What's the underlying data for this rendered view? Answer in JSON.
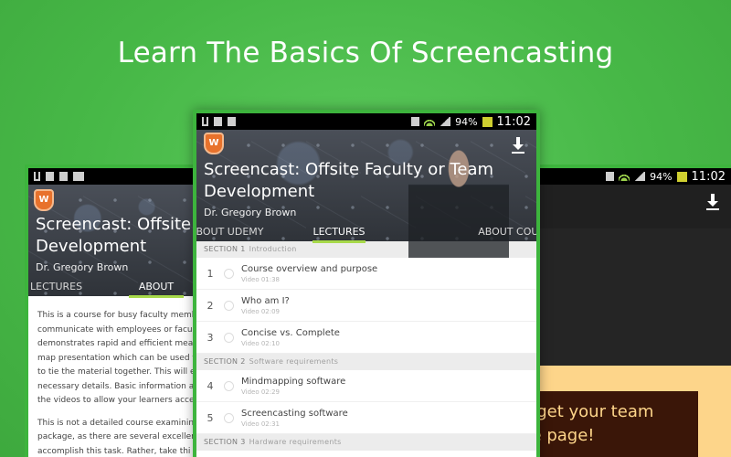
{
  "headline": "Learn The Basics Of Screencasting",
  "status": {
    "center": {
      "battery_pct": "94%",
      "time": "11:02"
    },
    "right": {
      "battery_pct": "94%",
      "time": "11:02"
    }
  },
  "course": {
    "title_line1": "Screencast:  Offsite Faculty or Team",
    "title_line2": "Development",
    "left_title_line1": "Screencast:  Offsite F",
    "left_title_line2": "Development",
    "instructor": "Dr. Gregory Brown",
    "brand_badge": "W"
  },
  "center_tabs": [
    "ABOUT UDEMY",
    "LECTURES",
    "ABOUT COURSE"
  ],
  "left_tabs": [
    "LECTURES",
    "ABOUT"
  ],
  "sections": [
    {
      "label": "SECTION 1",
      "name": "Introduction",
      "lectures": [
        {
          "num": "1",
          "title": "Course overview and purpose",
          "meta": "Video 01:38"
        },
        {
          "num": "2",
          "title": "Who am I?",
          "meta": "Video 02:09"
        },
        {
          "num": "3",
          "title": "Concise vs. Complete",
          "meta": "Video 02:10"
        }
      ]
    },
    {
      "label": "SECTION 2",
      "name": "Software requirements",
      "lectures": [
        {
          "num": "4",
          "title": "Mindmapping software",
          "meta": "Video 02:29"
        },
        {
          "num": "5",
          "title": "Screencasting software",
          "meta": "Video 02:31"
        }
      ]
    },
    {
      "label": "SECTION 3",
      "name": "Hardware requirements",
      "lectures": []
    }
  ],
  "left_description": [
    [
      "This is a course for busy faculty memb",
      "communicate with employees or facul",
      "demonstrates rapid and efficient mea",
      "map presentation which can be used t",
      "to tie the material together. This will e",
      "necessary details. Basic information a",
      "the videos to allow your learners acce"
    ],
    [
      "This is not a detailed course examinin",
      "package, as there are several excellen",
      "accomplish this task. Rather, take thi"
    ]
  ],
  "right_promo": [
    "g:  get your team",
    "me page!"
  ],
  "colors": {
    "background_green": "#47b847",
    "frame_green": "#3db43d",
    "tab_indicator": "#a7d94a",
    "brand_orange": "#e8722c"
  }
}
